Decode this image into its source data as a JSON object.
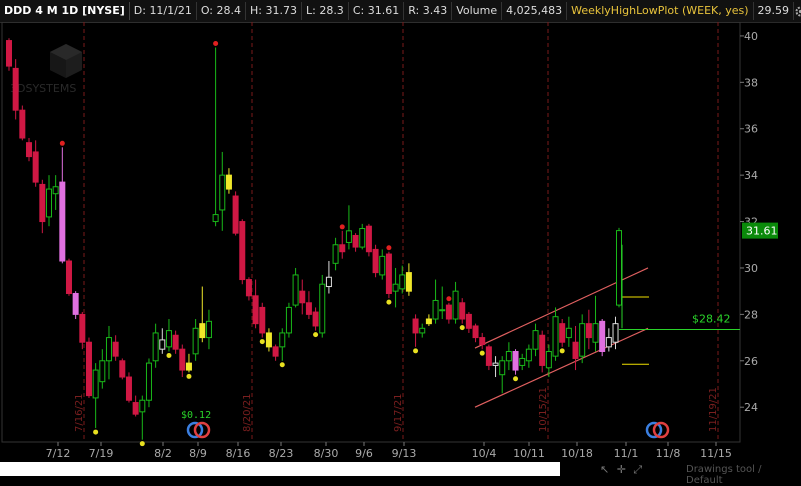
{
  "header": {
    "symbol": "DDD 4 M 1D [NYSE]",
    "date": "D: 11/1/21",
    "open": "O: 28.4",
    "high": "H: 31.73",
    "low": "L: 28.3",
    "close": "C: 31.61",
    "range": "R: 3.43",
    "volume_label": "Volume",
    "volume_value": "4,025,483",
    "study_label": "WeeklyHighLowPlot (WEEK, yes)",
    "study_value": "29.59"
  },
  "watermark": "3DSYSTEMS",
  "footer": {
    "drawings_label": "Drawings tool / Default"
  },
  "colors": {
    "up": "#19b919",
    "down": "#d01844",
    "highlight_yellow": "#f0e82a",
    "highlight_pink": "#e070e0",
    "hl_green": "#2ad42a",
    "price_tag": "#0a8a0a",
    "accent": "#e8c33c"
  },
  "chart_data": {
    "type": "candlestick",
    "ylim": [
      22.5,
      40.6
    ],
    "y_ticks": [
      24,
      26,
      28,
      30,
      32,
      34,
      36,
      38,
      40
    ],
    "x_tick_labels": [
      "7/12",
      "7/19",
      "8/2",
      "8/9",
      "8/16",
      "8/23",
      "8/30",
      "9/6",
      "9/13",
      "10/4",
      "10/11",
      "10/18",
      "11/1",
      "11/8",
      "11/15"
    ],
    "last_price_label": "31.61",
    "level_label": "$28.42",
    "level_value": 27.35,
    "dividend_label": "$0.12",
    "vertical_date_labels": [
      "7/16/21",
      "8/20/21",
      "9/17/21",
      "10/15/21",
      "11/19/21"
    ],
    "channel": {
      "upper": [
        [
          475,
          26.55
        ],
        [
          648,
          30.0
        ]
      ],
      "lower": [
        [
          475,
          24.0
        ],
        [
          648,
          27.4
        ]
      ]
    },
    "candles": [
      {
        "o": 39.8,
        "h": 39.9,
        "l": 38.5,
        "c": 38.7
      },
      {
        "o": 38.6,
        "h": 39.0,
        "l": 36.4,
        "c": 36.8
      },
      {
        "o": 36.8,
        "h": 37.0,
        "l": 35.5,
        "c": 35.6
      },
      {
        "o": 35.4,
        "h": 35.6,
        "l": 34.6,
        "c": 34.8
      },
      {
        "o": 35.0,
        "h": 35.5,
        "l": 33.5,
        "c": 33.7
      },
      {
        "o": 33.6,
        "h": 33.8,
        "l": 31.5,
        "c": 32.0
      },
      {
        "o": 32.2,
        "h": 34.0,
        "l": 31.8,
        "c": 33.4
      },
      {
        "o": 33.2,
        "h": 34.0,
        "l": 32.5,
        "c": 33.5
      },
      {
        "o": 33.7,
        "h": 35.2,
        "l": 30.2,
        "c": 30.3,
        "color": "pink"
      },
      {
        "o": 30.3,
        "h": 30.4,
        "l": 28.8,
        "c": 28.9
      },
      {
        "o": 28.9,
        "h": 29.0,
        "l": 27.8,
        "c": 28.0,
        "color": "pink"
      },
      {
        "o": 28.0,
        "h": 28.1,
        "l": 26.5,
        "c": 26.8
      },
      {
        "o": 26.8,
        "h": 27.0,
        "l": 24.4,
        "c": 24.5
      },
      {
        "o": 24.4,
        "h": 25.9,
        "l": 23.1,
        "c": 25.6
      },
      {
        "o": 25.1,
        "h": 26.5,
        "l": 24.8,
        "c": 26.0
      },
      {
        "o": 26.0,
        "h": 27.5,
        "l": 25.2,
        "c": 27.0
      },
      {
        "o": 26.8,
        "h": 27.1,
        "l": 26.0,
        "c": 26.2
      },
      {
        "o": 26.0,
        "h": 26.1,
        "l": 25.2,
        "c": 25.3
      },
      {
        "o": 25.3,
        "h": 25.5,
        "l": 24.2,
        "c": 24.3
      },
      {
        "o": 24.2,
        "h": 24.5,
        "l": 23.6,
        "c": 23.7
      },
      {
        "o": 23.8,
        "h": 24.5,
        "l": 22.6,
        "c": 24.3
      },
      {
        "o": 24.3,
        "h": 26.1,
        "l": 24.0,
        "c": 25.9
      },
      {
        "o": 26.0,
        "h": 27.6,
        "l": 25.7,
        "c": 27.2
      },
      {
        "o": 26.9,
        "h": 27.4,
        "l": 26.3,
        "c": 26.5,
        "color": "white"
      },
      {
        "o": 26.6,
        "h": 27.8,
        "l": 26.4,
        "c": 27.3
      },
      {
        "o": 27.1,
        "h": 27.3,
        "l": 26.3,
        "c": 26.5
      },
      {
        "o": 26.5,
        "h": 26.7,
        "l": 25.3,
        "c": 25.6
      },
      {
        "o": 25.6,
        "h": 26.3,
        "l": 25.5,
        "c": 25.9,
        "color": "yellow"
      },
      {
        "o": 26.3,
        "h": 27.8,
        "l": 26.0,
        "c": 27.4
      },
      {
        "o": 27.0,
        "h": 29.2,
        "l": 26.8,
        "c": 27.6,
        "color": "yellow"
      },
      {
        "o": 27.0,
        "h": 28.2,
        "l": 26.5,
        "c": 27.7
      },
      {
        "o": 32.0,
        "h": 39.5,
        "l": 31.8,
        "c": 32.3
      },
      {
        "o": 32.5,
        "h": 35.0,
        "l": 31.6,
        "c": 34.0
      },
      {
        "o": 34.0,
        "h": 34.3,
        "l": 33.2,
        "c": 33.4,
        "color": "yellow"
      },
      {
        "o": 33.1,
        "h": 33.3,
        "l": 31.4,
        "c": 31.5
      },
      {
        "o": 32.0,
        "h": 32.1,
        "l": 29.3,
        "c": 29.5
      },
      {
        "o": 29.5,
        "h": 29.6,
        "l": 28.6,
        "c": 28.8
      },
      {
        "o": 28.8,
        "h": 29.5,
        "l": 27.4,
        "c": 27.6
      },
      {
        "o": 28.3,
        "h": 28.5,
        "l": 27.0,
        "c": 27.2
      },
      {
        "o": 27.2,
        "h": 27.4,
        "l": 26.4,
        "c": 26.6,
        "color": "yellow"
      },
      {
        "o": 26.6,
        "h": 26.7,
        "l": 26.0,
        "c": 26.2
      },
      {
        "o": 26.6,
        "h": 27.4,
        "l": 26.0,
        "c": 27.2
      },
      {
        "o": 27.2,
        "h": 28.5,
        "l": 27.0,
        "c": 28.3
      },
      {
        "o": 28.4,
        "h": 30.0,
        "l": 28.3,
        "c": 29.7
      },
      {
        "o": 29.0,
        "h": 29.5,
        "l": 28.0,
        "c": 28.5
      },
      {
        "o": 28.5,
        "h": 29.0,
        "l": 27.8,
        "c": 28.0
      },
      {
        "o": 28.1,
        "h": 28.3,
        "l": 27.3,
        "c": 27.5
      },
      {
        "o": 27.2,
        "h": 29.7,
        "l": 27.0,
        "c": 29.3
      },
      {
        "o": 29.2,
        "h": 30.3,
        "l": 28.9,
        "c": 29.6,
        "color": "white"
      },
      {
        "o": 30.2,
        "h": 31.3,
        "l": 29.9,
        "c": 31.0
      },
      {
        "o": 31.0,
        "h": 31.6,
        "l": 30.4,
        "c": 30.7
      },
      {
        "o": 31.1,
        "h": 32.7,
        "l": 30.8,
        "c": 31.6
      },
      {
        "o": 31.4,
        "h": 31.5,
        "l": 30.7,
        "c": 30.9
      },
      {
        "o": 30.9,
        "h": 31.9,
        "l": 30.8,
        "c": 31.7
      },
      {
        "o": 31.8,
        "h": 31.9,
        "l": 30.5,
        "c": 30.7
      },
      {
        "o": 30.8,
        "h": 31.0,
        "l": 29.6,
        "c": 29.8
      },
      {
        "o": 29.7,
        "h": 30.8,
        "l": 29.5,
        "c": 30.5
      },
      {
        "o": 30.6,
        "h": 30.7,
        "l": 28.7,
        "c": 28.9
      },
      {
        "o": 29.0,
        "h": 30.0,
        "l": 28.3,
        "c": 29.3
      },
      {
        "o": 29.1,
        "h": 30.1,
        "l": 28.9,
        "c": 29.7
      },
      {
        "o": 29.8,
        "h": 30.2,
        "l": 28.8,
        "c": 29.0,
        "color": "yellow"
      },
      {
        "o": 27.8,
        "h": 28.0,
        "l": 26.6,
        "c": 27.2
      },
      {
        "o": 27.2,
        "h": 27.6,
        "l": 27.0,
        "c": 27.4
      },
      {
        "o": 27.8,
        "h": 28.0,
        "l": 27.5,
        "c": 27.6,
        "color": "yellow"
      },
      {
        "o": 27.8,
        "h": 29.5,
        "l": 27.6,
        "c": 28.6
      },
      {
        "o": 28.2,
        "h": 29.2,
        "l": 27.8,
        "c": 28.2
      },
      {
        "o": 28.4,
        "h": 28.5,
        "l": 27.6,
        "c": 27.8
      },
      {
        "o": 27.8,
        "h": 29.4,
        "l": 27.6,
        "c": 29.0
      },
      {
        "o": 28.5,
        "h": 28.7,
        "l": 27.6,
        "c": 27.8
      },
      {
        "o": 28.0,
        "h": 28.1,
        "l": 27.2,
        "c": 27.4
      },
      {
        "o": 27.5,
        "h": 27.6,
        "l": 26.8,
        "c": 27.0
      },
      {
        "o": 27.0,
        "h": 27.2,
        "l": 26.5,
        "c": 26.7
      },
      {
        "o": 26.6,
        "h": 26.7,
        "l": 25.6,
        "c": 25.8
      },
      {
        "o": 25.8,
        "h": 26.2,
        "l": 25.3,
        "c": 25.9,
        "color": "white"
      },
      {
        "o": 25.4,
        "h": 26.2,
        "l": 24.6,
        "c": 26.0
      },
      {
        "o": 26.0,
        "h": 26.8,
        "l": 25.6,
        "c": 26.4
      },
      {
        "o": 26.4,
        "h": 26.5,
        "l": 25.4,
        "c": 25.6,
        "color": "pink"
      },
      {
        "o": 25.8,
        "h": 26.3,
        "l": 25.6,
        "c": 26.1
      },
      {
        "o": 26.0,
        "h": 26.7,
        "l": 25.7,
        "c": 26.5
      },
      {
        "o": 26.5,
        "h": 27.6,
        "l": 26.2,
        "c": 27.3
      },
      {
        "o": 27.1,
        "h": 27.3,
        "l": 25.5,
        "c": 25.8
      },
      {
        "o": 25.7,
        "h": 26.7,
        "l": 25.3,
        "c": 26.4
      },
      {
        "o": 26.2,
        "h": 28.3,
        "l": 26.0,
        "c": 27.9
      },
      {
        "o": 27.6,
        "h": 27.8,
        "l": 26.6,
        "c": 26.8
      },
      {
        "o": 27.0,
        "h": 27.9,
        "l": 26.6,
        "c": 27.4
      },
      {
        "o": 26.8,
        "h": 27.5,
        "l": 25.6,
        "c": 26.1
      },
      {
        "o": 26.2,
        "h": 28.0,
        "l": 25.9,
        "c": 27.6
      },
      {
        "o": 27.6,
        "h": 28.2,
        "l": 26.5,
        "c": 27.0
      },
      {
        "o": 26.8,
        "h": 28.8,
        "l": 26.4,
        "c": 27.6
      },
      {
        "o": 27.7,
        "h": 27.8,
        "l": 26.2,
        "c": 26.4,
        "color": "pink"
      },
      {
        "o": 26.6,
        "h": 27.4,
        "l": 26.4,
        "c": 27.0,
        "color": "white"
      },
      {
        "o": 26.8,
        "h": 27.9,
        "l": 26.5,
        "c": 27.6,
        "color": "white"
      },
      {
        "o": 28.4,
        "h": 31.73,
        "l": 28.3,
        "c": 31.61
      }
    ]
  }
}
